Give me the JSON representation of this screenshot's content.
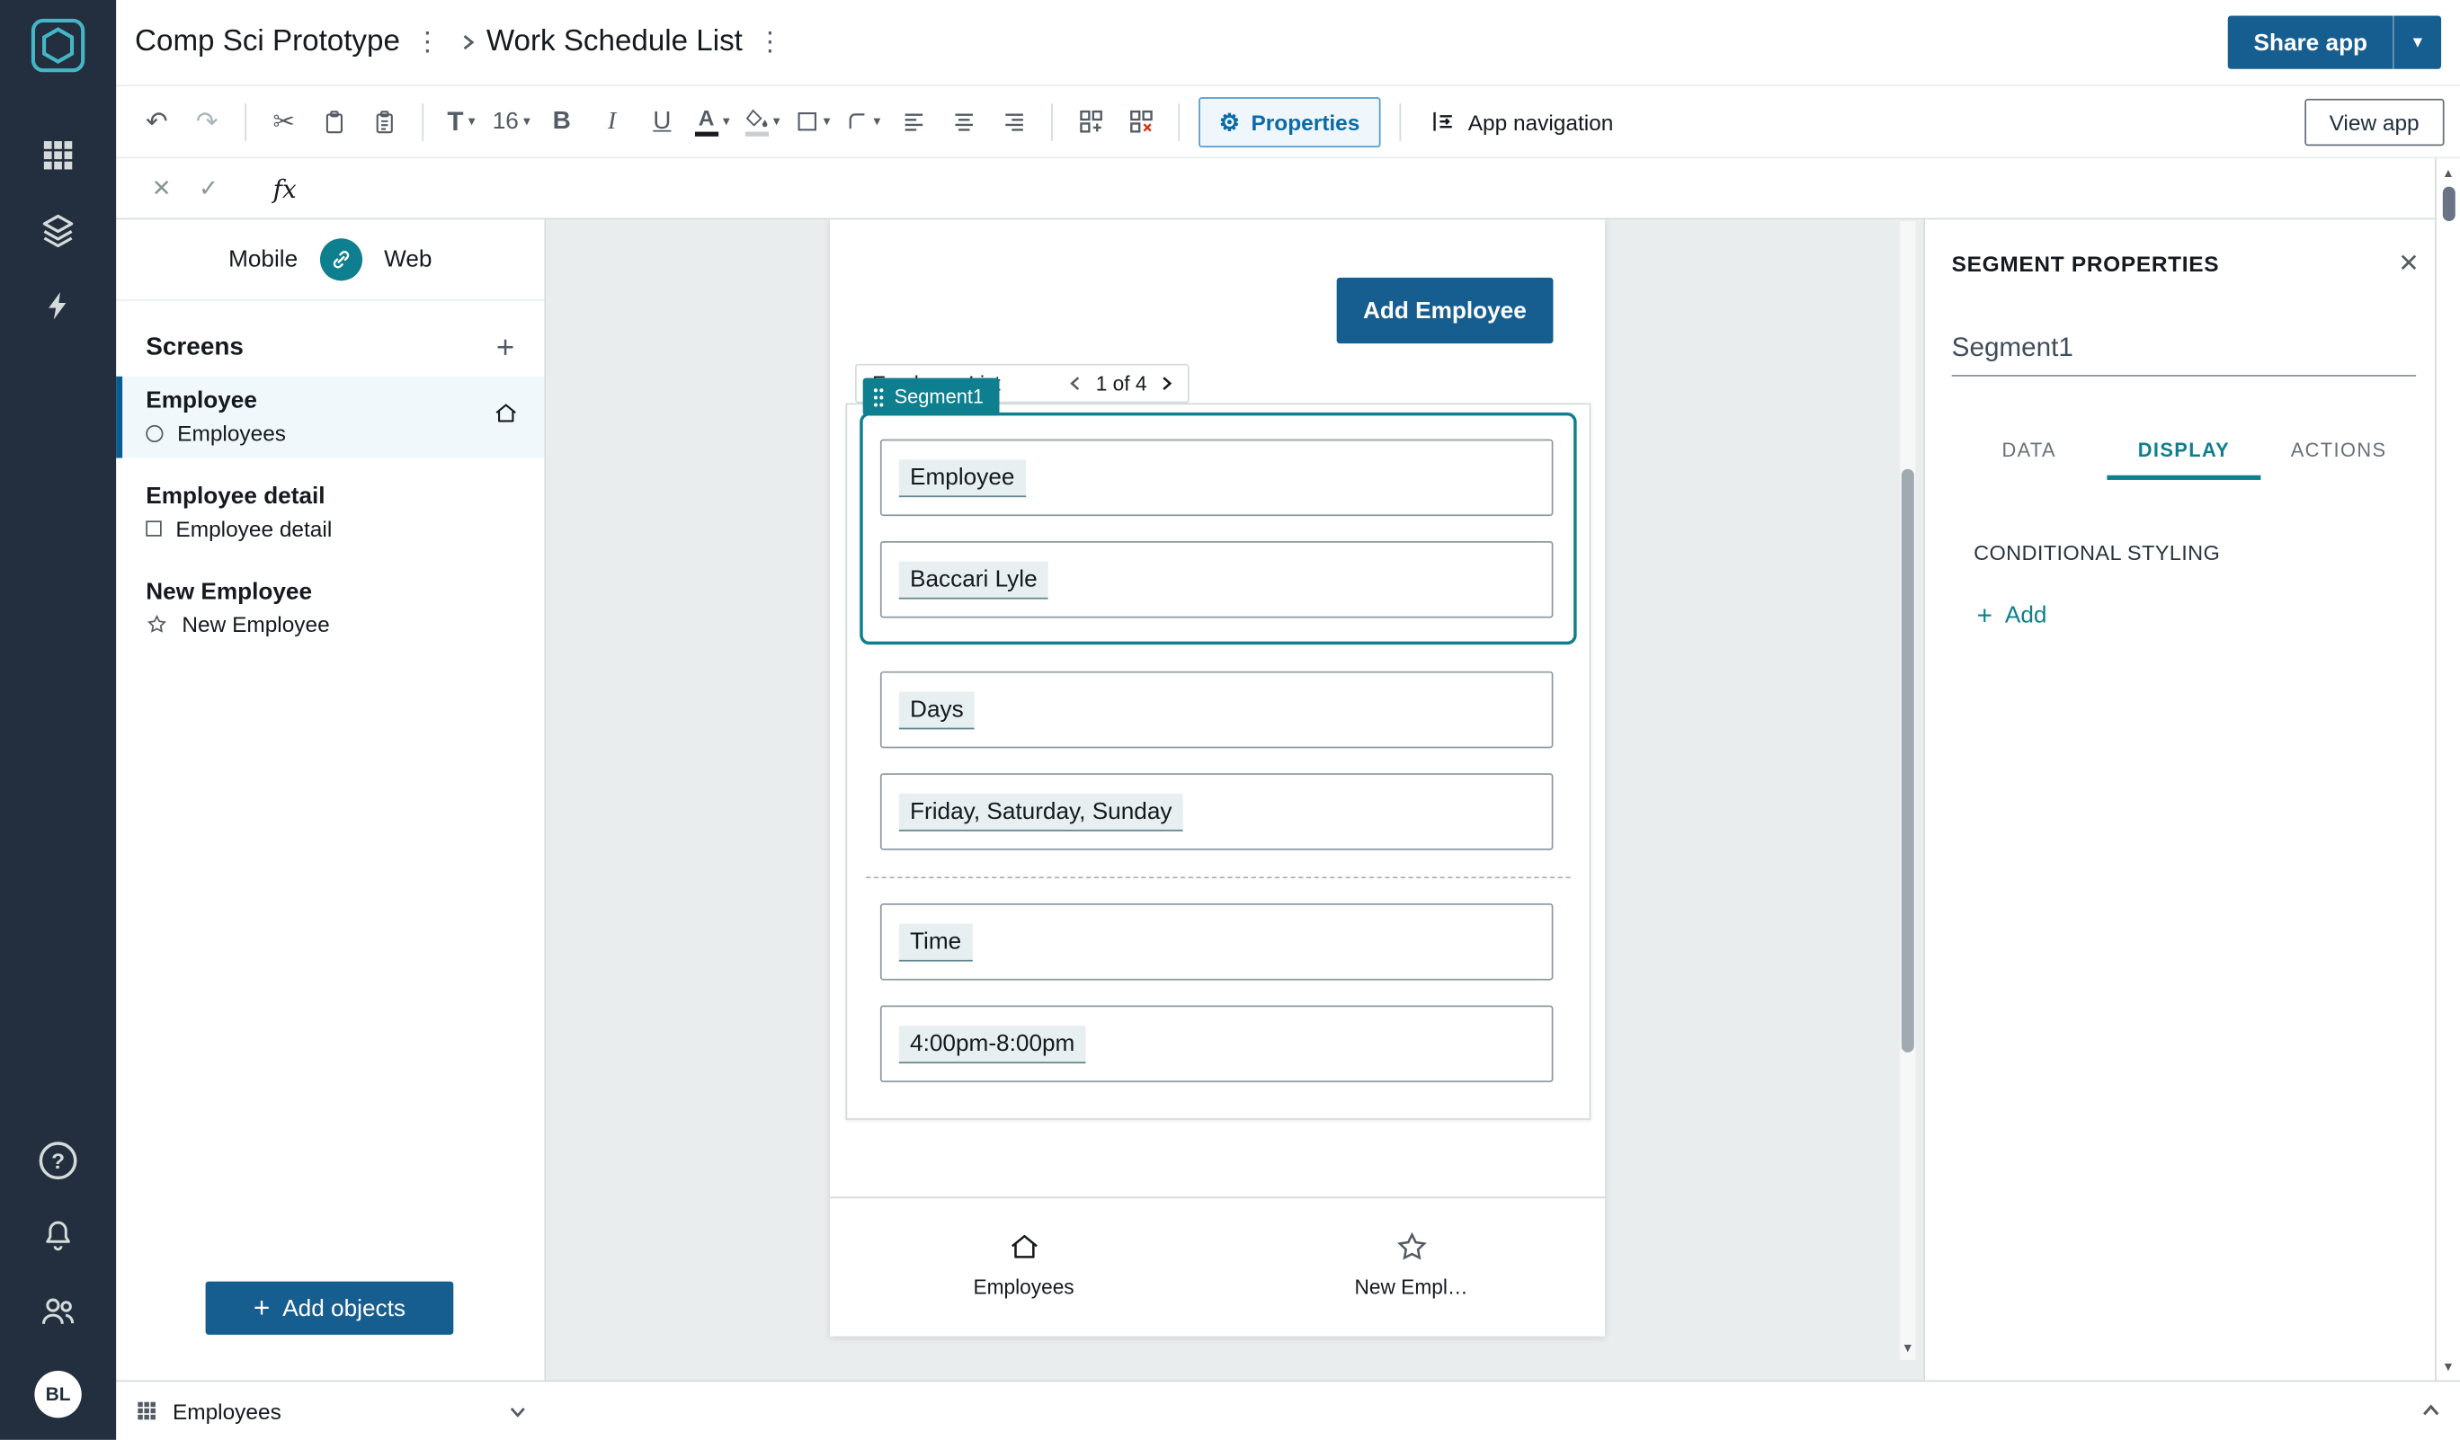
{
  "header": {
    "app_name": "Comp Sci Prototype",
    "screen_name": "Work Schedule List",
    "share_app": "Share app"
  },
  "toolbar": {
    "text_tool": "T",
    "font_size": "16",
    "bold": "B",
    "italic": "I",
    "underline": "U",
    "text_color": "A",
    "properties": "Properties",
    "app_navigation": "App navigation",
    "view_app": "View app"
  },
  "formula_bar": {
    "fx": "fx"
  },
  "left_panel": {
    "mobile": "Mobile",
    "web": "Web",
    "screens_title": "Screens",
    "screens": [
      {
        "title": "Employee",
        "subtitle": "Employees"
      },
      {
        "title": "Employee detail",
        "subtitle": "Employee detail"
      },
      {
        "title": "New Employee",
        "subtitle": "New Employee"
      }
    ],
    "add_objects": "Add objects"
  },
  "canvas": {
    "add_employee": "Add Employee",
    "segment_tag": "Segment1",
    "list_label": "Employee List",
    "page_indicator": "1 of 4",
    "fields": {
      "label1": "Employee",
      "value1": "Baccari Lyle",
      "label2": "Days",
      "value2": "Friday, Saturday, Sunday",
      "label3": "Time",
      "value3": "4:00pm-8:00pm"
    },
    "nav": {
      "item1": "Employees",
      "item2": "New Empl…"
    }
  },
  "right_panel": {
    "title": "SEGMENT PROPERTIES",
    "segment_name": "Segment1",
    "tabs": {
      "data": "DATA",
      "display": "DISPLAY",
      "actions": "ACTIONS"
    },
    "conditional_styling": "CONDITIONAL STYLING",
    "add": "Add"
  },
  "bottom_bar": {
    "table_name": "Employees"
  },
  "sidebar": {
    "avatar": "BL"
  },
  "colors": {
    "accent_teal": "#0e7f8e",
    "primary_blue": "#175e90",
    "sidebar_navy": "#232f3e"
  }
}
